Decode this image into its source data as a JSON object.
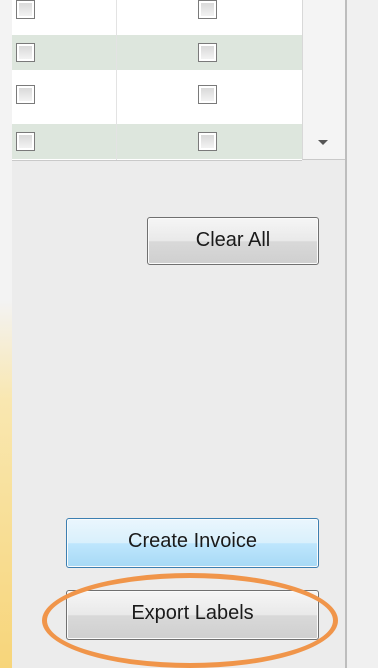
{
  "buttons": {
    "clear_all": "Clear All",
    "create_invoice": "Create Invoice",
    "export_labels": "Export Labels"
  },
  "table": {
    "rows": [
      {
        "checked_a": false,
        "checked_b": false
      },
      {
        "checked_a": false,
        "checked_b": false
      },
      {
        "checked_a": false,
        "checked_b": false
      },
      {
        "checked_a": false,
        "checked_b": false
      }
    ]
  },
  "colors": {
    "highlight_ring": "#f0954a",
    "alt_row": "#dde6dd",
    "primary_button": "#bee6fd"
  },
  "icons": {
    "scroll_down": "triangle-down-icon"
  }
}
